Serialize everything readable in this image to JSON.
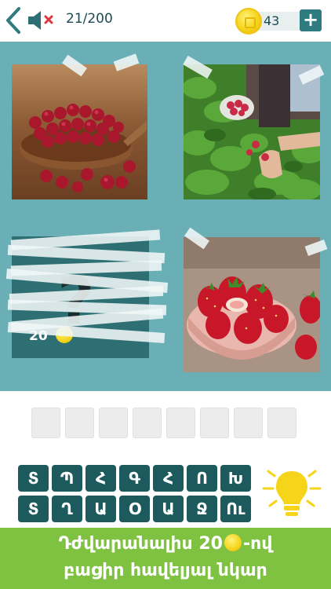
{
  "header": {
    "level_progress": "21/200",
    "coin_count": "43",
    "plus_label": "+"
  },
  "board": {
    "hidden_tile": {
      "question_mark": "?",
      "reveal_cost": "20"
    }
  },
  "keyboard": {
    "row1": [
      "Տ",
      "Պ",
      "Հ",
      "Գ",
      "Հ",
      "Ո",
      "Խ"
    ],
    "row2": [
      "Տ",
      "Ղ",
      "Ա",
      "Օ",
      "Ա",
      "Ջ",
      "Ու"
    ]
  },
  "banner": {
    "line1_before": "Դժվարանալիս 20",
    "line1_after": "-ով",
    "line2": "բացիր հավելյալ նկար"
  },
  "colors": {
    "board_teal": "#69afb5",
    "key_bg": "#1d5a5d",
    "banner_green": "#7fc242",
    "coin_gold": "#f5d419"
  }
}
